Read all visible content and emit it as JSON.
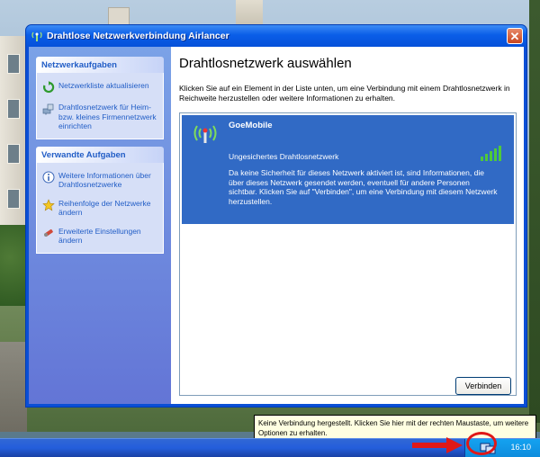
{
  "window": {
    "title": "Drahtlose Netzwerkverbindung Airlancer",
    "close_symbol": "✕"
  },
  "sidebar": {
    "panels": [
      {
        "title": "Netzwerkaufgaben",
        "items": [
          {
            "label": "Netzwerkliste aktualisieren",
            "icon": "refresh-icon"
          },
          {
            "label": "Drahtlosnetzwerk für Heim- bzw. kleines Firmennetzwerk einrichten",
            "icon": "network-setup-icon"
          }
        ]
      },
      {
        "title": "Verwandte Aufgaben",
        "items": [
          {
            "label": "Weitere Informationen über Drahtlosnetzwerke",
            "icon": "info-icon"
          },
          {
            "label": "Reihenfolge der Netzwerke ändern",
            "icon": "star-icon"
          },
          {
            "label": "Erweiterte Einstellungen ändern",
            "icon": "settings-icon"
          }
        ]
      }
    ]
  },
  "main": {
    "heading": "Drahtlosnetzwerk auswählen",
    "instructions": "Klicken Sie auf ein Element in der Liste unten, um eine Verbindung mit einem Drahtlosnetzwerk in Reichweite herzustellen oder weitere Informationen zu erhalten.",
    "networks": [
      {
        "name": "GoeMobile",
        "security": "Ungesichertes Drahtlosnetzwerk",
        "description": "Da keine Sicherheit für dieses Netzwerk aktiviert ist, sind Informationen, die über dieses Netzwerk gesendet werden, eventuell für andere Personen sichtbar. Klicken Sie auf \"Verbinden\", um eine Verbindung mit diesem Netzwerk herzustellen.",
        "signal_bars": 5,
        "selected": true
      }
    ],
    "connect_label": "Verbinden"
  },
  "tooltip": {
    "text": "Keine Verbindung hergestellt. Klicken Sie hier mit der rechten Maustaste, um weitere Optionen zu erhalten."
  },
  "taskbar": {
    "clock": "16:10"
  },
  "colors": {
    "title_bar": "#0a5ee8",
    "selection": "#316ac5",
    "task_link": "#215dc6",
    "signal_green": "#4fc93a",
    "annotation_red": "#e01818"
  }
}
